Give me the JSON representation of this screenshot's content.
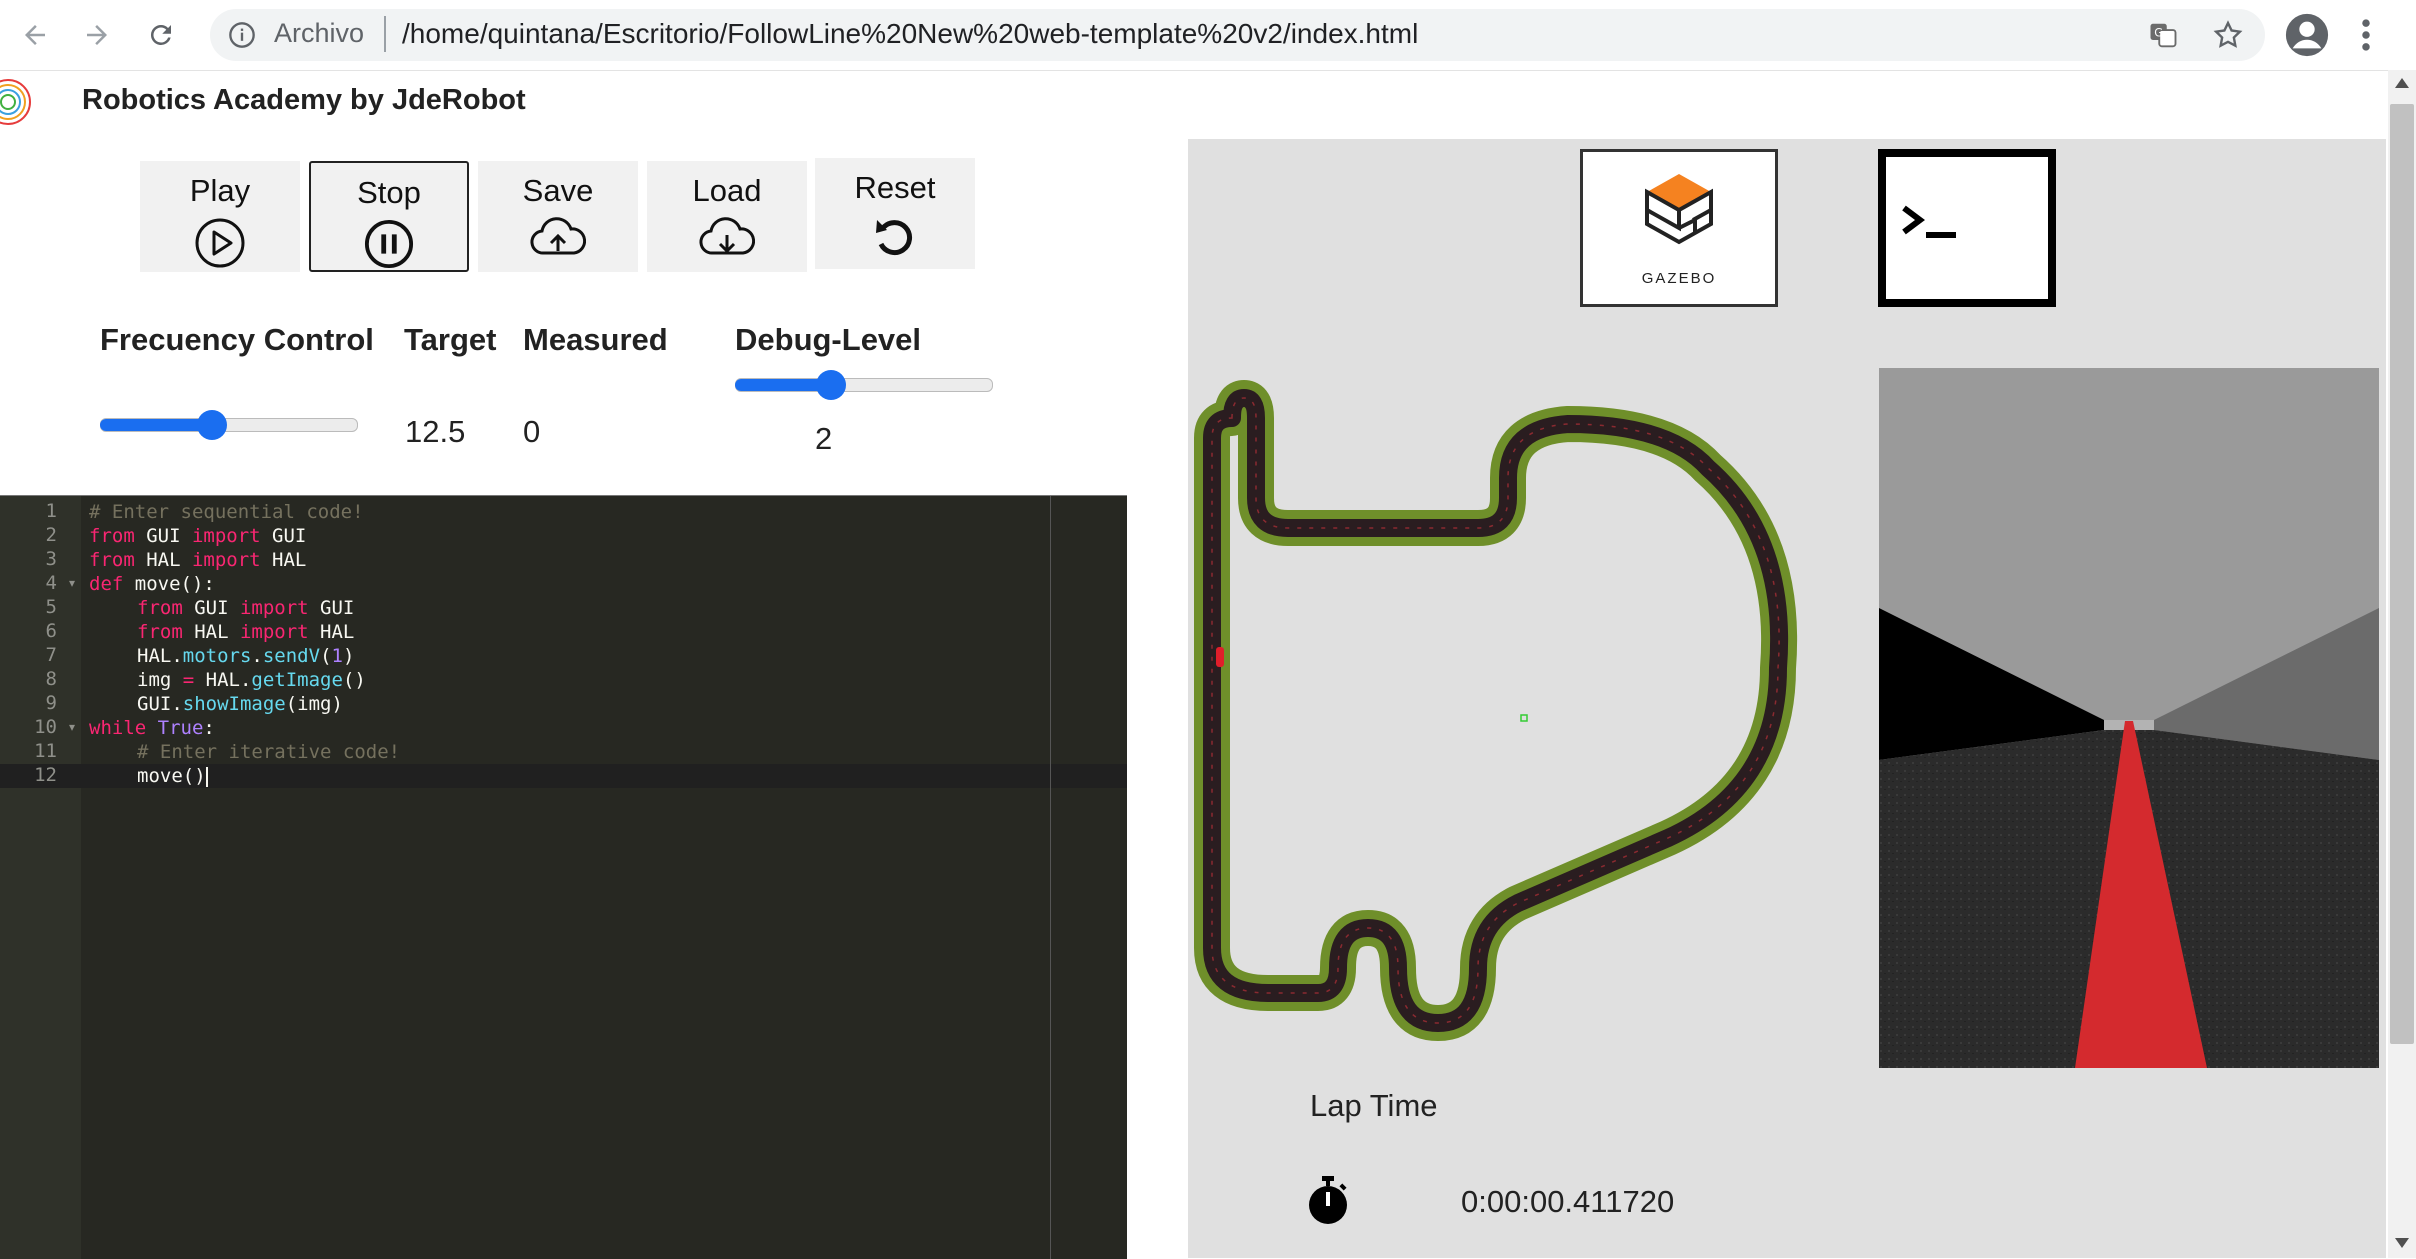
{
  "browser": {
    "back_label": "Back",
    "archivo_label": "Archivo",
    "url": "/home/quintana/Escritorio/FollowLine%20New%20web-template%20v2/index.html"
  },
  "app": {
    "title": "Robotics Academy by JdeRobot"
  },
  "controls": {
    "play": "Play",
    "stop": "Stop",
    "save": "Save",
    "load": "Load",
    "reset": "Reset"
  },
  "frequency": {
    "header": "Frecuency Control",
    "target_label": "Target",
    "measured_label": "Measured",
    "target_value": "12.5",
    "measured_value": "0",
    "slider_fraction": 0.43
  },
  "debug": {
    "header": "Debug-Level",
    "value": "2",
    "slider_fraction": 0.36
  },
  "editor": {
    "lines": [
      "1",
      "2",
      "3",
      "4",
      "5",
      "6",
      "7",
      "8",
      "9",
      "10",
      "11",
      "12"
    ],
    "code": {
      "l1": "# Enter sequential code!",
      "l2a": "from",
      "l2b": " GUI ",
      "l2c": "import",
      "l2d": " GUI",
      "l3a": "from",
      "l3b": " HAL ",
      "l3c": "import",
      "l3d": " HAL",
      "l4a": "def",
      "l4b": " move():",
      "l5a": "from",
      "l5b": " GUI ",
      "l5c": "import",
      "l5d": " GUI",
      "l6a": "from",
      "l6b": " HAL ",
      "l6c": "import",
      "l6d": " HAL",
      "l7a": "HAL.",
      "l7b": "motors",
      "l7c": ".",
      "l7d": "sendV",
      "l7e": "(",
      "l7f": "1",
      "l7g": ")",
      "l8a": "img ",
      "l8b": "=",
      "l8c": " HAL.",
      "l8d": "getImage",
      "l8e": "()",
      "l9a": "GUI.",
      "l9b": "showImage",
      "l9c": "(img)",
      "l10a": "while",
      "l10b": " True",
      "l10c": ":",
      "l11": "# Enter iterative code!",
      "l12": "move()"
    }
  },
  "simulation": {
    "gazebo_label": "GAZEBO",
    "lap_label": "Lap Time",
    "lap_value": "0:00:00.411720"
  },
  "colors": {
    "accent": "#1a6ef0",
    "editor_bg": "#272822",
    "track_green": "#6f8f2a",
    "track_dark": "#2a1d20",
    "line_red": "#d42a2e",
    "gazebo_orange": "#f58220"
  }
}
